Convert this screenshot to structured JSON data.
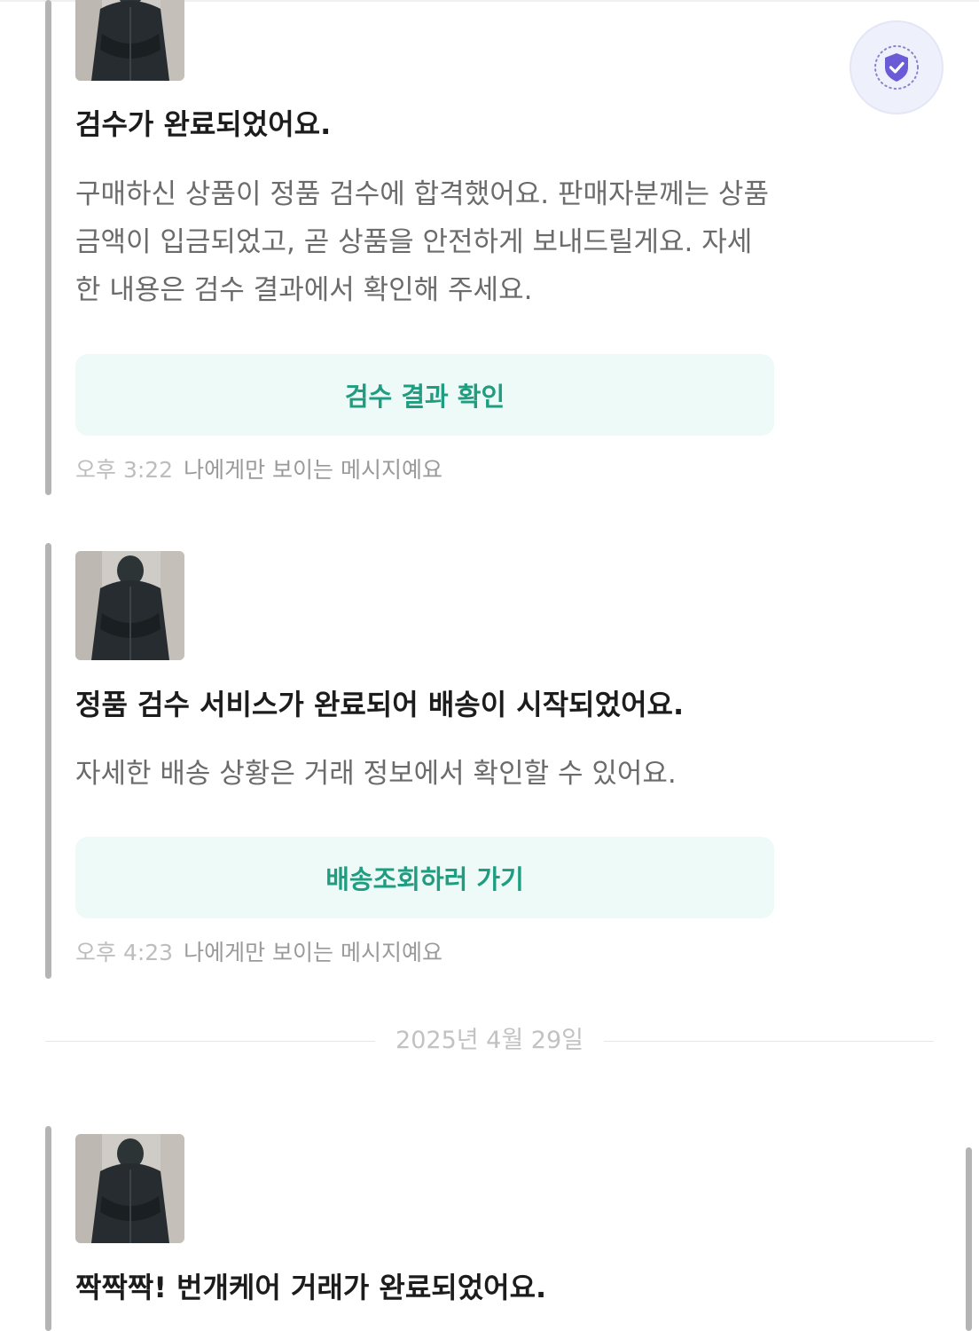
{
  "messages": [
    {
      "title": "검수가 완료되었어요.",
      "body": "구매하신 상품이 정품 검수에 합격했어요. 판매자분께는 상품 금액이 입금되었고, 곧 상품을 안전하게 보내드릴게요. 자세한 내용은 검수 결과에서 확인해 주세요.",
      "action_label": "검수 결과 확인",
      "time": "오후 3:22",
      "visibility_note": "나에게만 보이는 메시지예요"
    },
    {
      "title": "정품 검수 서비스가 완료되어 배송이 시작되었어요.",
      "body": "자세한 배송 상황은 거래 정보에서 확인할 수 있어요.",
      "action_label": "배송조회하러 가기",
      "time": "오후 4:23",
      "visibility_note": "나에게만 보이는 메시지예요"
    },
    {
      "title": "짝짝짝! 번개케어 거래가 완료되었어요."
    }
  ],
  "date_divider": "2025년 4월 29일",
  "icons": {
    "product_thumbnail": "product-photo-jacket",
    "fab": "shield-check-icon"
  },
  "colors": {
    "accent": "#1f9d80",
    "action_bg": "#eefaf7",
    "fab_purple": "#6b5bd6"
  }
}
